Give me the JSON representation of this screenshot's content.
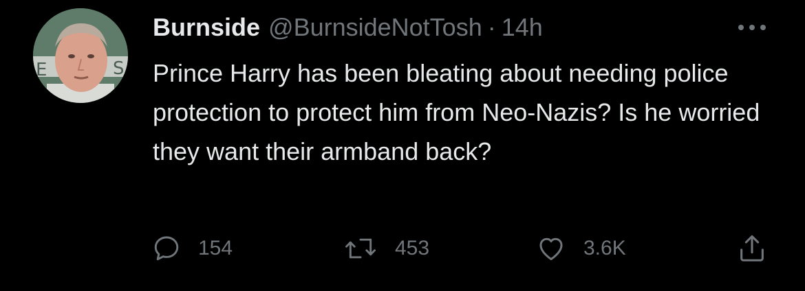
{
  "tweet": {
    "author_name": "Burnside",
    "author_handle": "@BurnsideNotTosh",
    "separator": "·",
    "time": "14h",
    "text": "Prince Harry has been bleating about needing police protection to protect him from Neo-Nazis? Is he worried they want their armband back?",
    "avatar_icon": "profile-photo",
    "more_icon": "more-horizontal-icon"
  },
  "actions": {
    "reply": {
      "icon": "reply-bubble-icon",
      "count": "154"
    },
    "retweet": {
      "icon": "retweet-icon",
      "count": "453"
    },
    "like": {
      "icon": "heart-icon",
      "count": "3.6K"
    },
    "share": {
      "icon": "share-upload-icon"
    }
  },
  "colors": {
    "background": "#000000",
    "primary_text": "#e7e9ea",
    "secondary_text": "#71767b"
  }
}
